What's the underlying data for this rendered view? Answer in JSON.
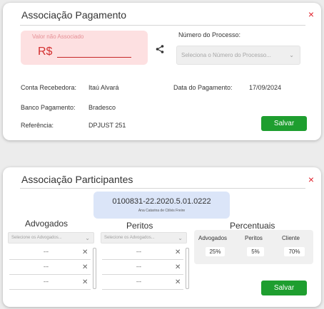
{
  "payment_card": {
    "title": "Associação Pagamento",
    "close": "×",
    "valor_placeholder": "Valor não Associado",
    "currency": "R$",
    "process_label": "Número do Processo:",
    "process_placeholder": "Seleciona o Número do Processo...",
    "fields": {
      "conta_label": "Conta Recebedora:",
      "conta_value": "Itaú Alvará",
      "data_label": "Data do Pagamento:",
      "data_value": "17/09/2024",
      "banco_label": "Banco Pagamento:",
      "banco_value": "Bradesco",
      "ref_label": "Referência:",
      "ref_value": "DPJUST 251"
    },
    "save": "Salvar"
  },
  "participants_card": {
    "title": "Associação Participantes",
    "close": "×",
    "process_number": "0100831-22.2020.5.01.0222",
    "process_name": "Ana Catarina de Ctilvis Freire",
    "advogados": {
      "title": "Advogados",
      "placeholder": "Selecione os Advogados...",
      "rows": [
        "---",
        "---",
        "---"
      ]
    },
    "peritos": {
      "title": "Peritos",
      "placeholder": "Selecione os Advogados...",
      "rows": [
        "---",
        "---",
        "---"
      ]
    },
    "percentuais": {
      "title": "Percentuais",
      "headers": [
        "Advogados",
        "Peritos",
        "Cliente"
      ],
      "values": [
        "25%",
        "5%",
        "70%"
      ]
    },
    "save": "Salvar"
  },
  "icons": {
    "close": "×",
    "remove": "✕",
    "chevron": "⌄"
  },
  "colors": {
    "accent_green": "#1e9e2f",
    "close_red": "#e0212b",
    "value_box": "#fde0e1",
    "process_box": "#dbe5f8"
  }
}
